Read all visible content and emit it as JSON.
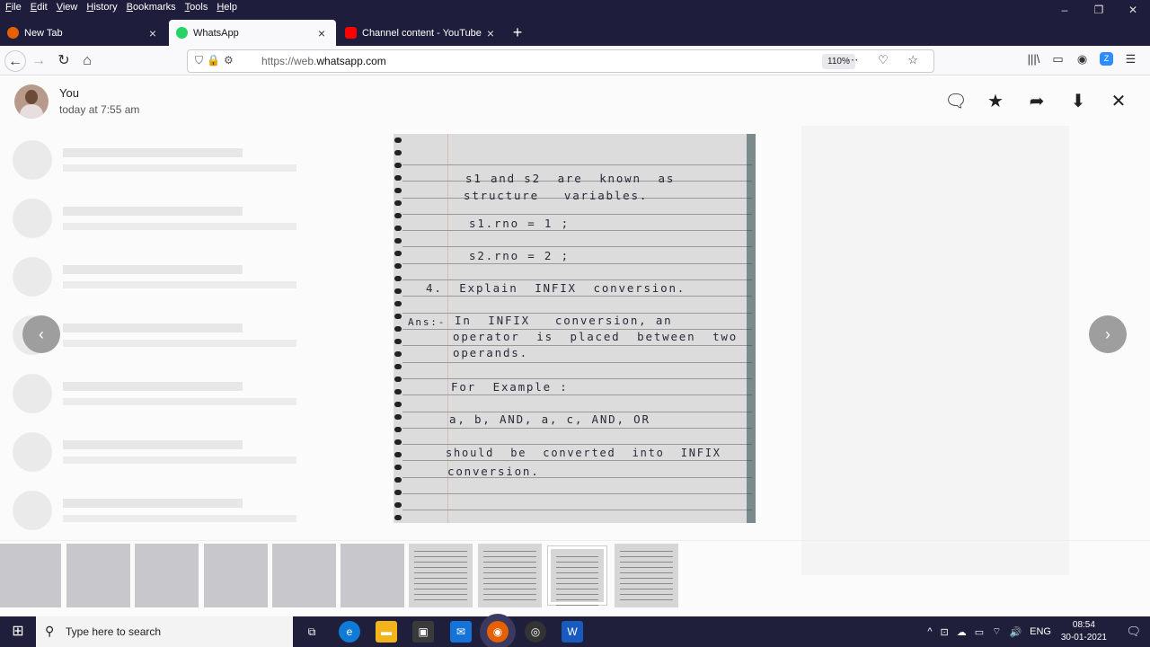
{
  "menubar": [
    "File",
    "Edit",
    "View",
    "History",
    "Bookmarks",
    "Tools",
    "Help"
  ],
  "window_controls": [
    "–",
    "❐",
    "✕"
  ],
  "tabs": [
    {
      "label": "New Tab",
      "icon": "firefox-icon",
      "icon_color": "#e66000"
    },
    {
      "label": "WhatsApp",
      "icon": "whatsapp-icon",
      "icon_color": "#25d366"
    },
    {
      "label": "Channel content - YouTube Stu",
      "icon": "youtube-icon",
      "icon_color": "#ff0000"
    }
  ],
  "new_tab_glyph": "+",
  "nav": {
    "back": "←",
    "forward": "→",
    "reload": "↻",
    "home": "⌂",
    "url_prefix": "https://web.",
    "url_host": "whatsapp.com",
    "zoom": "110%",
    "url_icons": "⛉🔒⚙",
    "page_actions": "⋯ ♡ ☆"
  },
  "toolbar_icons": [
    "|||\\",
    "▭",
    "◉",
    "Z",
    "☰"
  ],
  "media_viewer": {
    "sender": "You",
    "time": "today at 7:55 am",
    "icons": [
      "comment-icon",
      "star-icon",
      "forward-icon",
      "download-icon",
      "close-icon"
    ],
    "icon_glyphs": [
      "🗨",
      "★",
      "➦",
      "⬇",
      "✕"
    ],
    "prev_glyph": "‹",
    "next_glyph": "›"
  },
  "note_lines": [
    "s1 and s2  are  known  as",
    "structure   variables.",
    "s1.rno = 1 ;",
    "s2.rno = 2 ;",
    "4.  Explain  INFIX  conversion.",
    "Ans:-",
    "In  INFIX   conversion, an",
    "operator  is  placed  between  two",
    "operands.",
    "For  Example :",
    "a, b, AND, a, c, AND, OR",
    "should  be  converted  into  INFIX",
    "conversion."
  ],
  "taskbar": {
    "start": "⊞",
    "search_placeholder": "Type here to search",
    "apps": [
      {
        "name": "task-view-icon",
        "glyph": "⧉",
        "color": "#1f1e3b"
      },
      {
        "name": "edge-icon",
        "glyph": "e",
        "color": "#0f7bd6"
      },
      {
        "name": "file-explorer-icon",
        "glyph": "▬",
        "color": "#f2b31b"
      },
      {
        "name": "store-icon",
        "glyph": "▣",
        "color": "#3a3a3a"
      },
      {
        "name": "mail-icon",
        "glyph": "✉",
        "color": "#1572d6"
      },
      {
        "name": "firefox-icon",
        "glyph": "◉",
        "color": "#e66000"
      },
      {
        "name": "obs-icon",
        "glyph": "◎",
        "color": "#333"
      },
      {
        "name": "word-icon",
        "glyph": "W",
        "color": "#185abd"
      }
    ],
    "tray": [
      "^",
      "⊡",
      "☁",
      "▭",
      "⌔",
      "🔊",
      "ENG"
    ],
    "time": "08:54",
    "date": "30-01-2021",
    "notifications": "🗨"
  }
}
